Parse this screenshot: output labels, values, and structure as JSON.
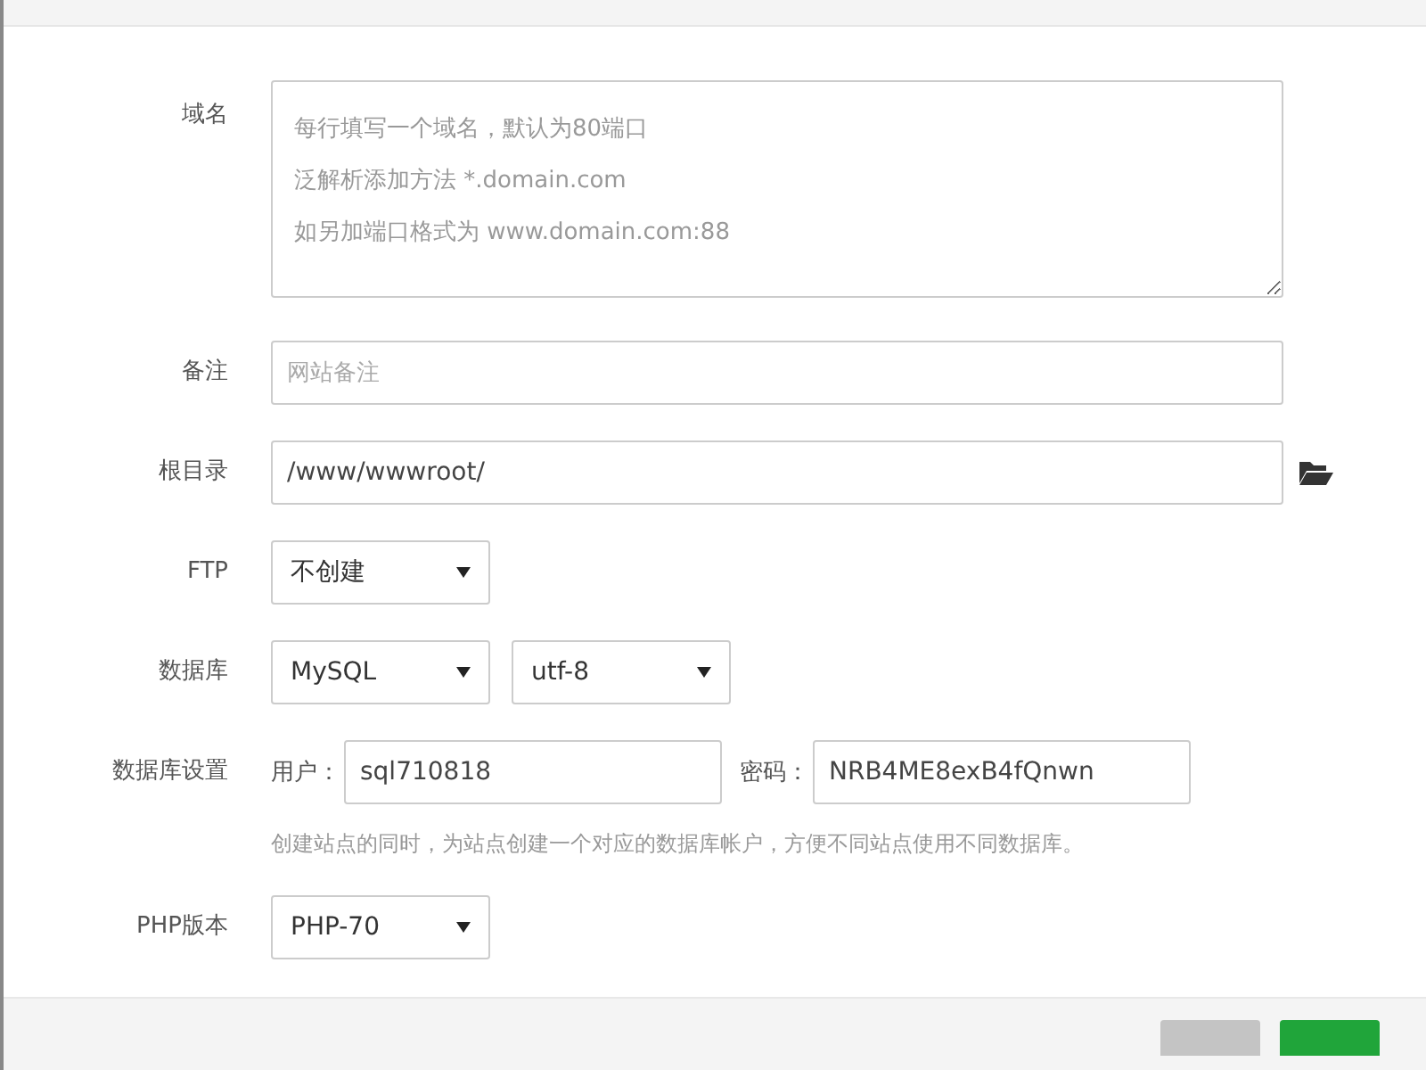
{
  "form": {
    "fields": [
      {
        "kind": "textarea",
        "label": "域名",
        "placeholder_lines": [
          "每行填写一个域名，默认为80端口",
          "泛解析添加方法 *.domain.com",
          "如另加端口格式为 www.domain.com:88"
        ]
      },
      {
        "kind": "input",
        "label": "备注",
        "placeholder": "网站备注"
      },
      {
        "kind": "path",
        "label": "根目录",
        "value": "/www/wwwroot/"
      },
      {
        "kind": "selects",
        "label": "FTP",
        "selects": [
          "不创建"
        ]
      },
      {
        "kind": "selects",
        "label": "数据库",
        "selects": [
          "MySQL",
          "utf-8"
        ]
      },
      {
        "kind": "credentials",
        "label": "数据库设置",
        "user_label": "用户：",
        "user": "sql710818",
        "password_label": "密码：",
        "password": "NRB4ME8exB4fQnwn",
        "help": "创建站点的同时，为站点创建一个对应的数据库帐户，方便不同站点使用不同数据库。"
      },
      {
        "kind": "selects",
        "label": "PHP版本",
        "selects": [
          "PHP-70"
        ]
      }
    ]
  },
  "footer_buttons": [
    {
      "kind": "cancel"
    },
    {
      "kind": "confirm"
    }
  ]
}
